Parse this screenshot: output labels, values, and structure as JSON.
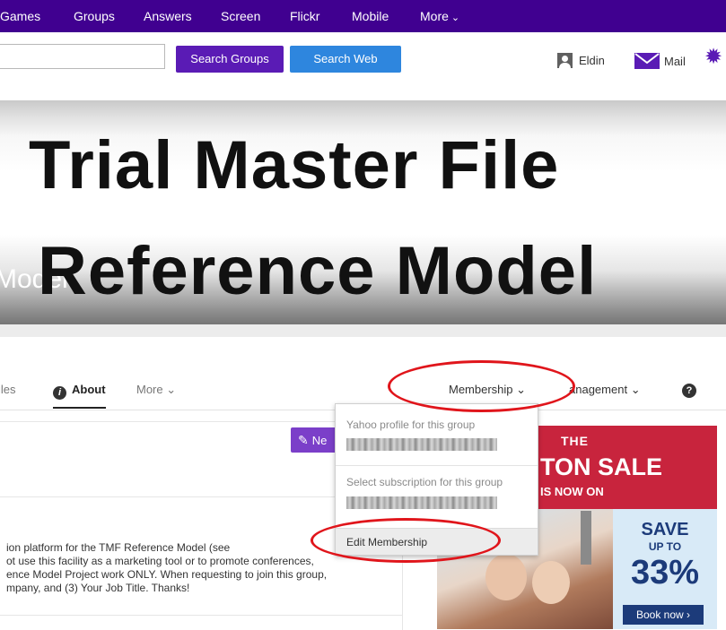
{
  "nav": {
    "items": [
      {
        "label": "Games"
      },
      {
        "label": "Groups"
      },
      {
        "label": "Answers"
      },
      {
        "label": "Screen"
      },
      {
        "label": "Flickr"
      },
      {
        "label": "Mobile"
      },
      {
        "label": "More"
      }
    ]
  },
  "search": {
    "value": "",
    "groups_button": "Search Groups",
    "web_button": "Search Web"
  },
  "user": {
    "name": "Eldin",
    "mail_label": "Mail"
  },
  "banner": {
    "title_line1": "Trial Master File",
    "title_line2": "Reference Model",
    "group_name": "Model"
  },
  "tabs": {
    "files": "iles",
    "about": "About",
    "more": "More",
    "membership": "Membership",
    "management": "anagement"
  },
  "content": {
    "new_topic_button": "Ne",
    "description_lines": [
      "ion platform for the TMF Reference Model (see",
      "ot use this facility as a marketing tool or to promote conferences,",
      "ence Model Project work ONLY. When requesting to join this group,",
      "mpany, and (3) Your Job Title. Thanks!"
    ]
  },
  "dropdown": {
    "profile_label": "Yahoo profile for this group",
    "subscription_label": "Select subscription for this group",
    "edit_membership": "Edit Membership"
  },
  "ad": {
    "the": "THE",
    "sale": "TON SALE",
    "now": "IS NOW ON",
    "save": "SAVE",
    "upto": "UP TO",
    "percent": "33%",
    "book_button": "Book now  ›"
  },
  "colors": {
    "nav_bg": "#400090",
    "search_groups_bg": "#5a1bb5",
    "search_web_bg": "#2e86de",
    "annotation_red": "#e0151b",
    "ad_red": "#c8243d",
    "ad_navy": "#1c3b7a"
  }
}
